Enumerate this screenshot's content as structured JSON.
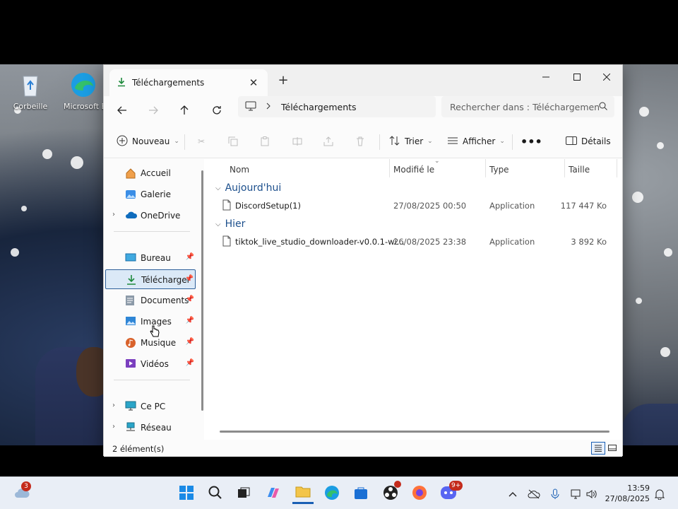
{
  "desktop": {
    "icons": [
      {
        "label": "Corbeille",
        "icon": "recycle-bin-icon"
      },
      {
        "label": "Microsoft E",
        "icon": "edge-icon"
      }
    ]
  },
  "window": {
    "tab_title": "Téléchargements",
    "address": {
      "path": "Téléchargements",
      "search_placeholder": "Rechercher dans : Téléchargemen"
    },
    "toolbar": {
      "new_label": "Nouveau",
      "sort_label": "Trier",
      "view_label": "Afficher",
      "details_label": "Détails"
    },
    "sidebar": {
      "top": [
        {
          "label": "Accueil",
          "icon": "home-icon"
        },
        {
          "label": "Galerie",
          "icon": "gallery-icon"
        },
        {
          "label": "OneDrive",
          "icon": "onedrive-icon"
        }
      ],
      "pinned": [
        {
          "label": "Bureau",
          "icon": "desktop-folder-icon"
        },
        {
          "label": "Téléchargem",
          "icon": "download-icon"
        },
        {
          "label": "Documents",
          "icon": "documents-icon"
        },
        {
          "label": "Images",
          "icon": "images-icon"
        },
        {
          "label": "Musique",
          "icon": "music-icon"
        },
        {
          "label": "Vidéos",
          "icon": "videos-icon"
        }
      ],
      "bottom": [
        {
          "label": "Ce PC",
          "icon": "pc-icon"
        },
        {
          "label": "Réseau",
          "icon": "network-icon"
        }
      ]
    },
    "columns": {
      "name": "Nom",
      "modified": "Modifié le",
      "type": "Type",
      "size": "Taille"
    },
    "groups": [
      {
        "label": "Aujourd'hui",
        "files": [
          {
            "name": "DiscordSetup(1)",
            "modified": "27/08/2025 00:50",
            "type": "Application",
            "size": "117 447 Ko"
          }
        ]
      },
      {
        "label": "Hier",
        "files": [
          {
            "name": "tiktok_live_studio_downloader-v0.0.1-wi...",
            "modified": "26/08/2025 23:38",
            "type": "Application",
            "size": "3 892 Ko"
          }
        ]
      }
    ],
    "status": "2 élément(s)"
  },
  "taskbar": {
    "weather_badge": "3",
    "discord_badge": "9+",
    "time": "13:59",
    "date": "27/08/2025"
  },
  "colors": {
    "accent": "#1a5fb4",
    "group_header": "#1c4f8c",
    "selection": "#dbe9f7",
    "badge": "#c42b1c"
  }
}
